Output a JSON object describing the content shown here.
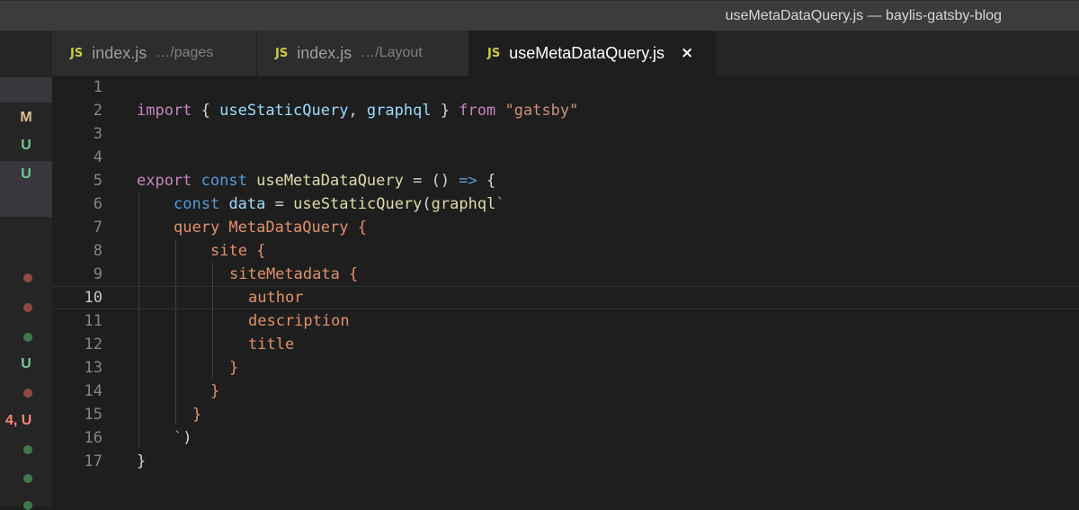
{
  "window": {
    "title": "useMetaDataQuery.js — baylis-gatsby-blog"
  },
  "tabs": [
    {
      "icon": "JS",
      "name": "index.js",
      "path": "…/pages"
    },
    {
      "icon": "JS",
      "name": "index.js",
      "path": "…/Layout"
    },
    {
      "icon": "JS",
      "name": "useMetaDataQuery.js",
      "close": "×"
    }
  ],
  "explorer": {
    "badges": [
      "M",
      "U",
      "U",
      "U",
      "4, U"
    ]
  },
  "editor": {
    "active_line": 10,
    "line_numbers": [
      "1",
      "2",
      "3",
      "4",
      "5",
      "6",
      "7",
      "8",
      "9",
      "10",
      "11",
      "12",
      "13",
      "14",
      "15",
      "16",
      "17"
    ],
    "lines": {
      "l2": {
        "t1": "import",
        "t2": " { ",
        "t3": "useStaticQuery",
        "t4": ", ",
        "t5": "graphql",
        "t6": " } ",
        "t7": "from",
        "t8": " ",
        "t9": "\"gatsby\""
      },
      "l5": {
        "t1": "export",
        "t2": " ",
        "t3": "const",
        "t4": " ",
        "t5": "useMetaDataQuery",
        "t6": " = () ",
        "t7": "=>",
        "t8": " {"
      },
      "l6": {
        "t1": "const",
        "t2": " ",
        "t3": "data",
        "t4": " = ",
        "t5": "useStaticQuery",
        "t6": "(",
        "t7": "graphql",
        "t8": "`"
      },
      "l7": {
        "t1": "query MetaDataQuery {"
      },
      "l8": {
        "t1": "site {"
      },
      "l9": {
        "t1": "siteMetadata {"
      },
      "l10": {
        "t1": "author"
      },
      "l11": {
        "t1": "description"
      },
      "l12": {
        "t1": "title"
      },
      "l13": {
        "t1": "}"
      },
      "l14": {
        "t1": "}"
      },
      "l15": {
        "t1": "}"
      },
      "l16": {
        "t1": "`",
        "t2": ")"
      },
      "l17": {
        "t1": "}"
      }
    }
  }
}
